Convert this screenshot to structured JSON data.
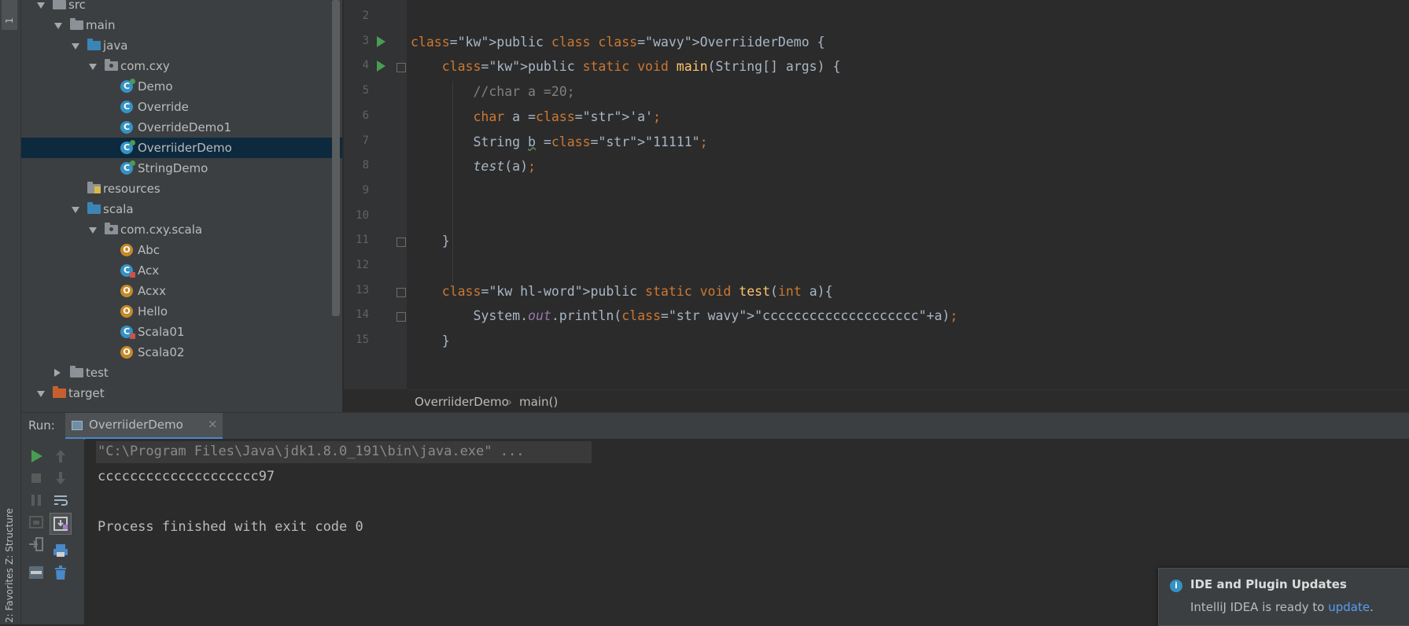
{
  "side_tabs": {
    "top_label": "1",
    "structure": "Z: Structure",
    "favorites": "2: Favorites"
  },
  "project_tree": [
    {
      "label": "src",
      "type": "folder",
      "indent": 0,
      "expanded": true
    },
    {
      "label": "main",
      "type": "folder",
      "indent": 1,
      "expanded": true
    },
    {
      "label": "java",
      "type": "folder-src",
      "indent": 2,
      "expanded": true
    },
    {
      "label": "com.cxy",
      "type": "package",
      "indent": 3,
      "expanded": true
    },
    {
      "label": "Demo",
      "type": "java-run",
      "indent": 4
    },
    {
      "label": "Override",
      "type": "java",
      "indent": 4
    },
    {
      "label": "OverrideDemo1",
      "type": "java",
      "indent": 4
    },
    {
      "label": "OverriiderDemo",
      "type": "java-run",
      "indent": 4,
      "selected": true
    },
    {
      "label": "StringDemo",
      "type": "java-run",
      "indent": 4
    },
    {
      "label": "resources",
      "type": "folder-res",
      "indent": 2
    },
    {
      "label": "scala",
      "type": "folder-src",
      "indent": 2,
      "expanded": true
    },
    {
      "label": "com.cxy.scala",
      "type": "package",
      "indent": 3,
      "expanded": true
    },
    {
      "label": "Abc",
      "type": "object",
      "indent": 4
    },
    {
      "label": "Acx",
      "type": "java-err",
      "indent": 4
    },
    {
      "label": "Acxx",
      "type": "object",
      "indent": 4
    },
    {
      "label": "Hello",
      "type": "object",
      "indent": 4
    },
    {
      "label": "Scala01",
      "type": "java-err",
      "indent": 4
    },
    {
      "label": "Scala02",
      "type": "object",
      "indent": 4
    },
    {
      "label": "test",
      "type": "folder",
      "indent": 1,
      "expanded": false
    },
    {
      "label": "target",
      "type": "folder-target",
      "indent": 0,
      "expanded": true
    }
  ],
  "editor": {
    "line_numbers": [
      "2",
      "3",
      "4",
      "5",
      "6",
      "7",
      "8",
      "9",
      "10",
      "11",
      "12",
      "13",
      "14",
      "15"
    ],
    "lines": [
      "",
      "public class OverriiderDemo {",
      "    public static void main(String[] args) {",
      "        //char a =20;",
      "        char a ='a';",
      "        String b =\"11111\";",
      "        test(a);",
      "",
      "",
      "    }",
      "",
      "    public static void test(int a){",
      "        System.out.println(\"cccccccccccccccccccc\"+a);",
      "    }"
    ]
  },
  "breadcrumb": {
    "class_name": "OverriiderDemo",
    "separator": "›",
    "method": "main()"
  },
  "run_panel": {
    "label": "Run:",
    "tab_name": "OverriiderDemo",
    "tab_close": "×"
  },
  "console": {
    "lines": [
      "\"C:\\Program Files\\Java\\jdk1.8.0_191\\bin\\java.exe\" ...",
      "cccccccccccccccccccc97",
      "",
      "Process finished with exit code 0"
    ]
  },
  "notification": {
    "title": "IDE and Plugin Updates",
    "body_prefix": "IntelliJ IDEA is ready to ",
    "link": "update",
    "body_suffix": "."
  },
  "colors": {
    "keyword": "#cc7832",
    "string": "#6a8759",
    "comment": "#808080",
    "function": "#ffc66d",
    "run_green": "#499c54",
    "link": "#589df6"
  }
}
